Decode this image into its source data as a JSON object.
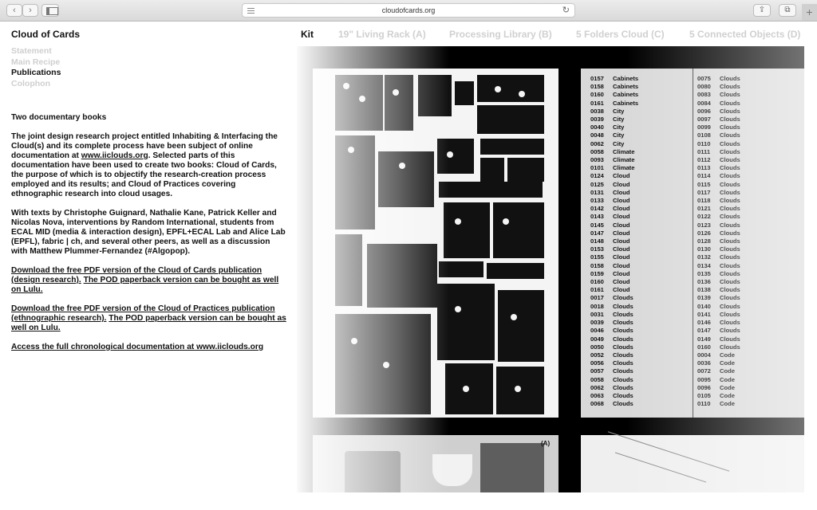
{
  "browser": {
    "url": "cloudofcards.org",
    "back_icon": "‹",
    "forward_icon": "›",
    "reload_icon": "↻",
    "share_icon": "⇪",
    "tabs_icon": "⧉",
    "new_tab_icon": "+"
  },
  "site": {
    "title": "Cloud of Cards",
    "nav": [
      {
        "label": "Statement",
        "active": false
      },
      {
        "label": "Main Recipe",
        "active": false
      },
      {
        "label": "Publications",
        "active": true
      },
      {
        "label": "Colophon",
        "active": false
      }
    ]
  },
  "projects_nav": [
    {
      "label": "Kit",
      "active": true
    },
    {
      "label": "19\" Living Rack (A)",
      "active": false
    },
    {
      "label": "Processing Library (B)",
      "active": false
    },
    {
      "label": "5 Folders Cloud (C)",
      "active": false
    },
    {
      "label": "5 Connected Objects (D)",
      "active": false
    }
  ],
  "content": {
    "heading": "Two documentary books",
    "para1_a": "The joint design research project entitled Inhabiting & Interfacing the Cloud(s) and its complete process have been subject of online documentation at ",
    "para1_link": "www.iiclouds.org",
    "para1_b": ". Selected parts of this documentation have been used to create two books: Cloud of Cards, the purpose of which is to objectify the research-creation process employed and its results; and Cloud of Practices covering ethnographic research into cloud usages.",
    "para2": "With texts by Christophe Guignard, Nathalie Kane, Patrick Keller and Nicolas Nova, interventions by Random International, students from ECAL MID (media & interaction design), EPFL+ECAL Lab and Alice Lab (EPFL), fabric | ch, and several other peers, as well as a discussion with Matthew Plummer-Fernandez (#Algopop).",
    "link1": "Download the free PDF version of the Cloud of Cards publication (design research).",
    "link1b": "The POD paperback version can be bought as well on Lulu.",
    "link2": "Download the free PDF version of the Cloud of Practices publication (ethnographic research).",
    "link2b": "The POD paperback version can be bought as well on Lulu.",
    "link3": "Access the full chronological documentation at www.iiclouds.org"
  },
  "card_list": {
    "left": [
      [
        "0157",
        "Cabinets"
      ],
      [
        "0158",
        "Cabinets"
      ],
      [
        "0160",
        "Cabinets"
      ],
      [
        "0161",
        "Cabinets"
      ],
      [
        "0038",
        "City"
      ],
      [
        "0039",
        "City"
      ],
      [
        "0040",
        "City"
      ],
      [
        "0048",
        "City"
      ],
      [
        "0062",
        "City"
      ],
      [
        "0058",
        "Climate"
      ],
      [
        "0093",
        "Climate"
      ],
      [
        "0101",
        "Climate"
      ],
      [
        "0124",
        "Cloud"
      ],
      [
        "0125",
        "Cloud"
      ],
      [
        "0131",
        "Cloud"
      ],
      [
        "0133",
        "Cloud"
      ],
      [
        "0142",
        "Cloud"
      ],
      [
        "0143",
        "Cloud"
      ],
      [
        "0145",
        "Cloud"
      ],
      [
        "0147",
        "Cloud"
      ],
      [
        "0148",
        "Cloud"
      ],
      [
        "0153",
        "Cloud"
      ],
      [
        "0155",
        "Cloud"
      ],
      [
        "0158",
        "Cloud"
      ],
      [
        "0159",
        "Cloud"
      ],
      [
        "0160",
        "Cloud"
      ],
      [
        "0161",
        "Cloud"
      ],
      [
        "0017",
        "Clouds"
      ],
      [
        "0018",
        "Clouds"
      ],
      [
        "0031",
        "Clouds"
      ],
      [
        "0039",
        "Clouds"
      ],
      [
        "0046",
        "Clouds"
      ],
      [
        "0049",
        "Clouds"
      ],
      [
        "0050",
        "Clouds"
      ],
      [
        "0052",
        "Clouds"
      ],
      [
        "0056",
        "Clouds"
      ],
      [
        "0057",
        "Clouds"
      ],
      [
        "0058",
        "Clouds"
      ],
      [
        "0062",
        "Clouds"
      ],
      [
        "0063",
        "Clouds"
      ],
      [
        "0068",
        "Clouds"
      ]
    ],
    "right": [
      [
        "0075",
        "Clouds"
      ],
      [
        "0080",
        "Clouds"
      ],
      [
        "0083",
        "Clouds"
      ],
      [
        "0084",
        "Clouds"
      ],
      [
        "0096",
        "Clouds"
      ],
      [
        "0097",
        "Clouds"
      ],
      [
        "0099",
        "Clouds"
      ],
      [
        "0108",
        "Clouds"
      ],
      [
        "0110",
        "Clouds"
      ],
      [
        "0111",
        "Clouds"
      ],
      [
        "0112",
        "Clouds"
      ],
      [
        "0113",
        "Clouds"
      ],
      [
        "0114",
        "Clouds"
      ],
      [
        "0115",
        "Clouds"
      ],
      [
        "0117",
        "Clouds"
      ],
      [
        "0118",
        "Clouds"
      ],
      [
        "0121",
        "Clouds"
      ],
      [
        "0122",
        "Clouds"
      ],
      [
        "0123",
        "Clouds"
      ],
      [
        "0126",
        "Clouds"
      ],
      [
        "0128",
        "Clouds"
      ],
      [
        "0130",
        "Clouds"
      ],
      [
        "0132",
        "Clouds"
      ],
      [
        "0134",
        "Clouds"
      ],
      [
        "0135",
        "Clouds"
      ],
      [
        "0136",
        "Clouds"
      ],
      [
        "0138",
        "Clouds"
      ],
      [
        "0139",
        "Clouds"
      ],
      [
        "0140",
        "Clouds"
      ],
      [
        "0141",
        "Clouds"
      ],
      [
        "0146",
        "Clouds"
      ],
      [
        "0147",
        "Clouds"
      ],
      [
        "0149",
        "Clouds"
      ],
      [
        "0160",
        "Clouds"
      ],
      [
        "0004",
        "Code"
      ],
      [
        "0036",
        "Code"
      ],
      [
        "0072",
        "Code"
      ],
      [
        "0095",
        "Code"
      ],
      [
        "0096",
        "Code"
      ],
      [
        "0105",
        "Code"
      ],
      [
        "0110",
        "Code"
      ]
    ]
  },
  "image_label": "(A)"
}
